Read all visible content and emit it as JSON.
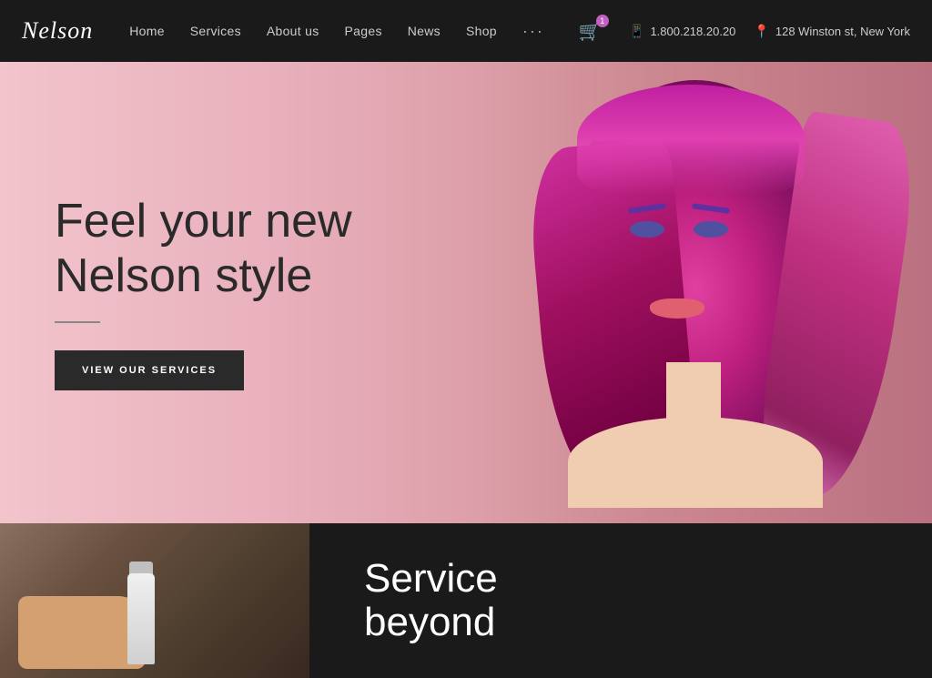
{
  "brand": {
    "logo": "Nelson"
  },
  "navbar": {
    "links": [
      {
        "label": "Home",
        "id": "home"
      },
      {
        "label": "Services",
        "id": "services"
      },
      {
        "label": "About us",
        "id": "about"
      },
      {
        "label": "Pages",
        "id": "pages"
      },
      {
        "label": "News",
        "id": "news"
      },
      {
        "label": "Shop",
        "id": "shop"
      }
    ],
    "more_label": "···",
    "cart_count": "1",
    "phone": "1.800.218.20.20",
    "address": "128 Winston st, New York"
  },
  "hero": {
    "title_line1": "Feel your new",
    "title_line2": "Nelson style",
    "cta_label": "VIEW OUR SERVICES"
  },
  "below_hero": {
    "service_title_line1": "Service",
    "service_title_line2": "beyond"
  }
}
